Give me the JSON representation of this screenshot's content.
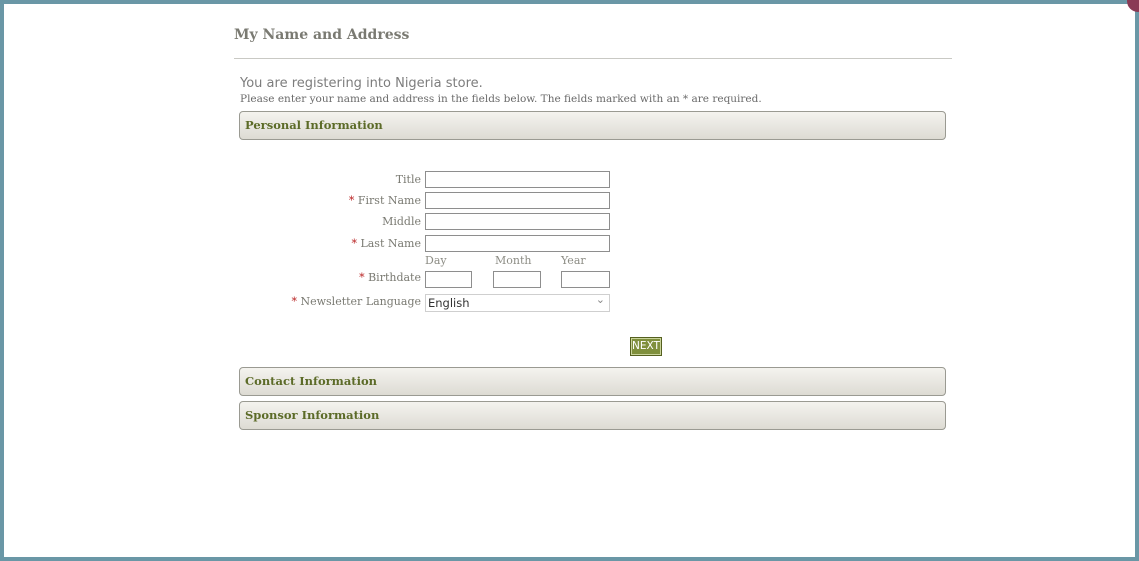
{
  "page_title": "My Name and Address",
  "store_line": "You are registering into Nigeria store.",
  "instructions": "Please enter your name and address in the fields below. The fields marked with an * are required.",
  "sections": {
    "personal": "Personal Information",
    "contact": "Contact Information",
    "sponsor": "Sponsor Information"
  },
  "required_marker": "*",
  "fields": {
    "title": {
      "label": "Title",
      "value": ""
    },
    "first_name": {
      "label": "First Name",
      "value": ""
    },
    "middle": {
      "label": "Middle",
      "value": ""
    },
    "last_name": {
      "label": "Last Name",
      "value": ""
    },
    "birthdate": {
      "label": "Birthdate",
      "day_label": "Day",
      "month_label": "Month",
      "year_label": "Year",
      "day": "",
      "month": "",
      "year": ""
    },
    "newsletter_language": {
      "label": "Newsletter Language",
      "value": "English"
    }
  },
  "next_label": "NEXT",
  "colors": {
    "frame": "#6a97a6",
    "section_text": "#5c6b28",
    "required": "#b82020",
    "button": "#7f8f3c"
  }
}
